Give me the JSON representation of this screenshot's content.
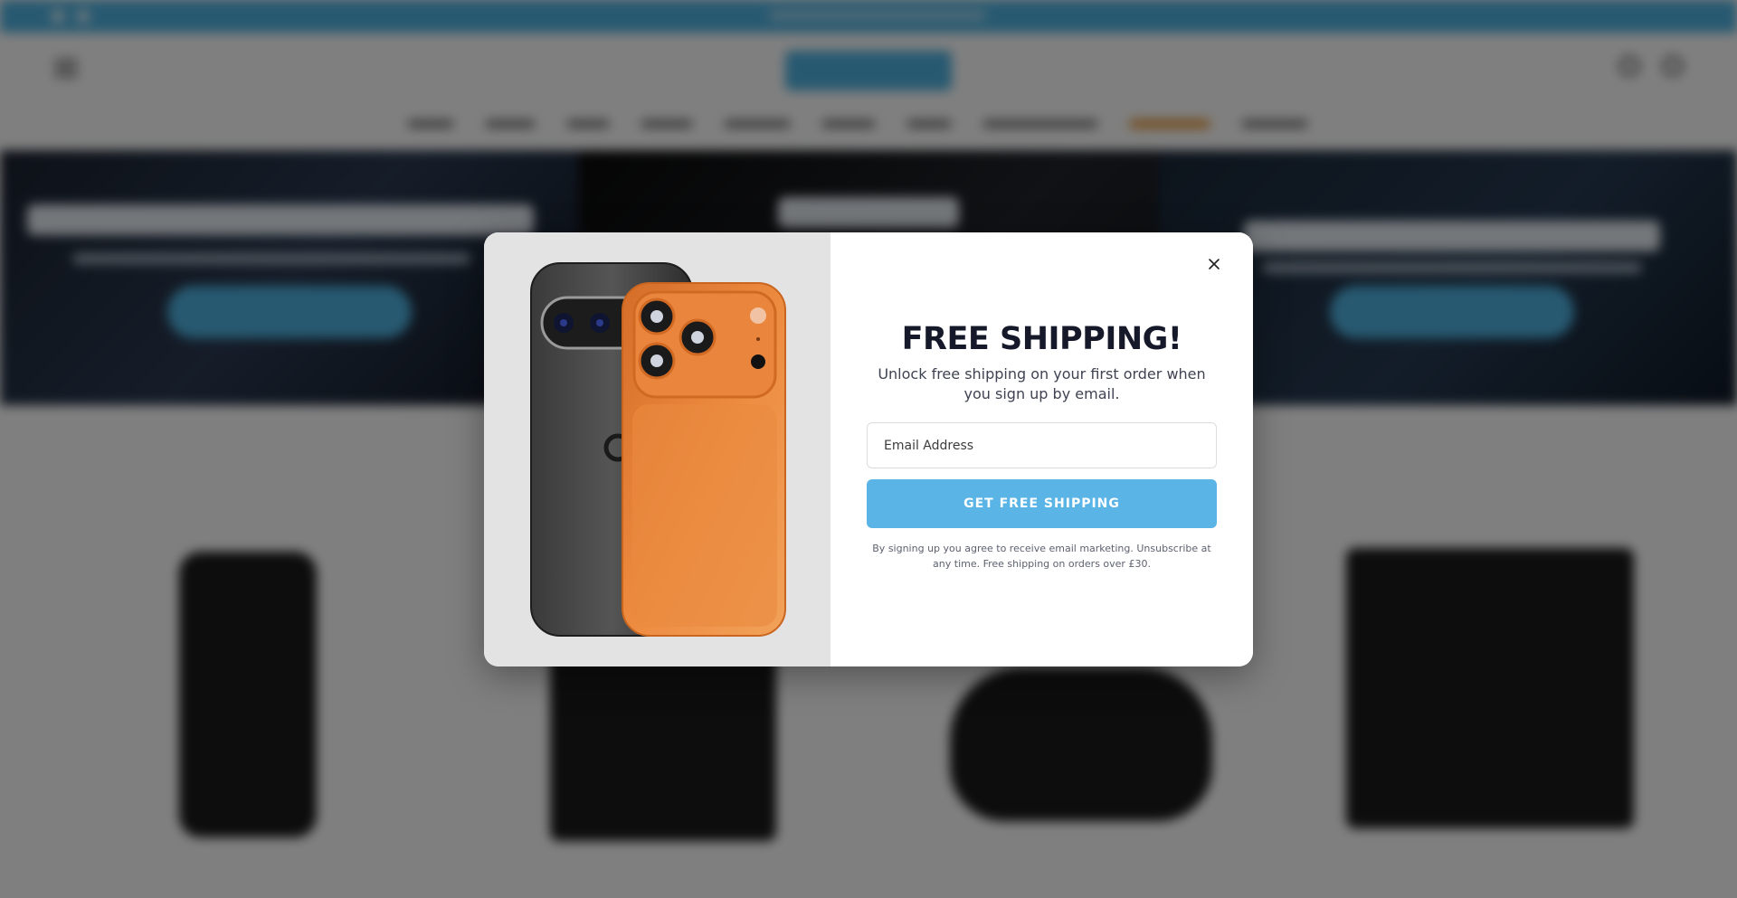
{
  "popup": {
    "title": "FREE SHIPPING!",
    "description": "Unlock free shipping on your first order when you sign up by email.",
    "email_placeholder": "Email Address",
    "email_value": "",
    "submit_label": "GET FREE SHIPPING",
    "disclaimer": "By signing up you agree to receive email marketing. Unsubscribe at any time. Free shipping on orders over £30.",
    "close_icon": "close-icon",
    "image": "two smartphones, black and orange, rear view"
  },
  "colors": {
    "accent": "#5ab4e6",
    "topbar": "#4fb3e2",
    "highlight_nav": "#e89a3b",
    "title_text": "#16192a"
  }
}
